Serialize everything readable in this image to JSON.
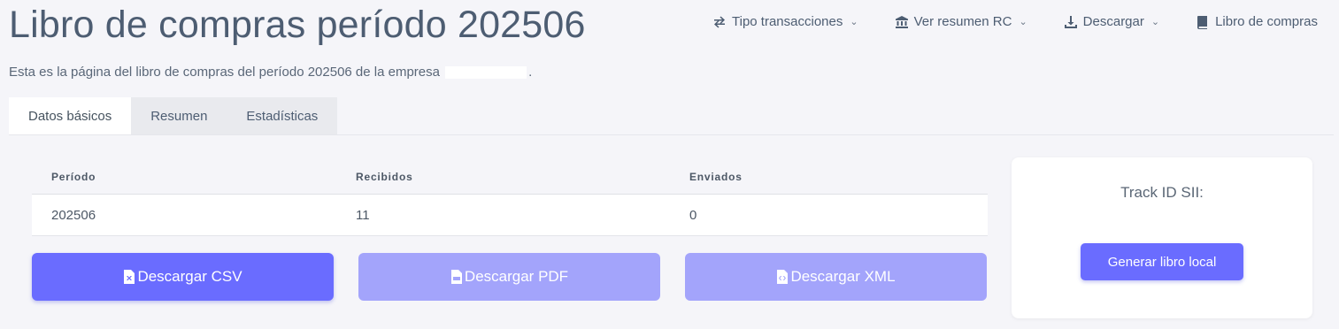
{
  "header": {
    "title": "Libro de compras período 202506",
    "subtitle_before": "Esta es la página del libro de compras del período 202506 de la empresa",
    "subtitle_after": "."
  },
  "topnav": {
    "items": [
      {
        "label": "Tipo transacciones",
        "icon": "exchange-icon",
        "dropdown": true
      },
      {
        "label": "Ver resumen RC",
        "icon": "bank-icon",
        "dropdown": true
      },
      {
        "label": "Descargar",
        "icon": "download-icon",
        "dropdown": true
      },
      {
        "label": "Libro de compras",
        "icon": "book-icon",
        "dropdown": false
      }
    ]
  },
  "tabs": [
    {
      "label": "Datos básicos",
      "active": true
    },
    {
      "label": "Resumen",
      "active": false
    },
    {
      "label": "Estadísticas",
      "active": false
    }
  ],
  "table": {
    "headers": [
      "Período",
      "Recibidos",
      "Enviados"
    ],
    "rows": [
      [
        "202506",
        "11",
        "0"
      ]
    ]
  },
  "buttons": {
    "csv": "Descargar CSV",
    "pdf": "Descargar PDF",
    "xml": "Descargar XML"
  },
  "card": {
    "track_label": "Track ID SII:",
    "generate_label": "Generar libro local"
  },
  "colors": {
    "primary": "#6a6cff",
    "primary_light": "#a3a4fb",
    "background": "#f5f5f9"
  }
}
